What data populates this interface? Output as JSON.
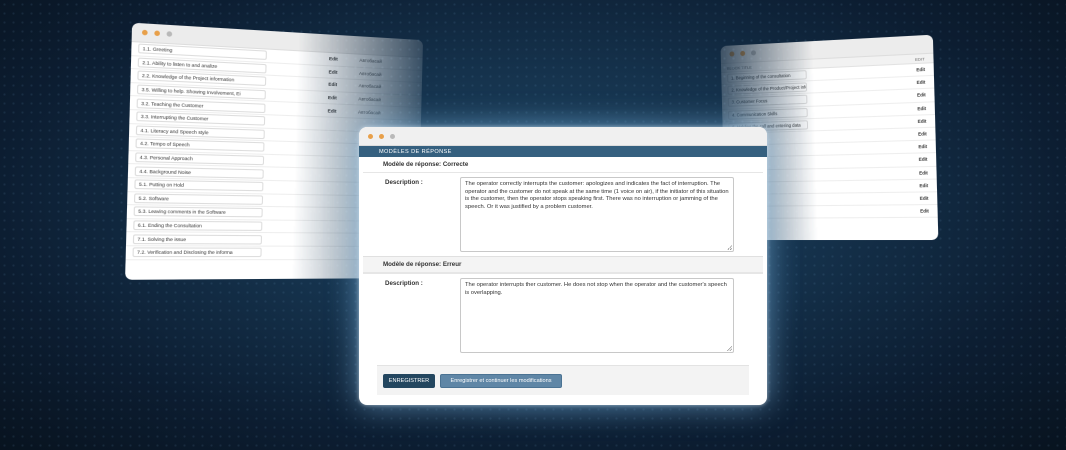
{
  "left_window": {
    "rows": [
      {
        "label": "1.1. Greeting",
        "edit": "Edit",
        "action": "Автобасай"
      },
      {
        "label": "2.1. Ability to listen to and analize",
        "edit": "Edit",
        "action": "Автобасай"
      },
      {
        "label": "2.2. Knowledge of the Project information",
        "edit": "Edit",
        "action": "Автобасай"
      },
      {
        "label": "3.5. Willing to help. Showing Involvement, Ei",
        "edit": "Edit",
        "action": "Автобасай"
      },
      {
        "label": "3.2. Teaching the Customer",
        "edit": "Edit",
        "action": "Автобасай"
      },
      {
        "label": "3.3. Interrupting the Customer",
        "edit": "",
        "action": ""
      },
      {
        "label": "4.1. Literacy and Speech style",
        "edit": "",
        "action": ""
      },
      {
        "label": "4.2. Tempo of Speech",
        "edit": "",
        "action": ""
      },
      {
        "label": "4.3. Personal Approach",
        "edit": "",
        "action": ""
      },
      {
        "label": "4.4. Background Noise",
        "edit": "",
        "action": ""
      },
      {
        "label": "5.1. Putting on Hold",
        "edit": "",
        "action": ""
      },
      {
        "label": "5.2. Software",
        "edit": "",
        "action": ""
      },
      {
        "label": "5.3. Leaving comments in the Software",
        "edit": "",
        "action": ""
      },
      {
        "label": "6.1. Ending the Consultation",
        "edit": "",
        "action": ""
      },
      {
        "label": "7.1. Solving the issue",
        "edit": "",
        "action": ""
      },
      {
        "label": "7.2. Verification and Disclosing the informa",
        "edit": "",
        "action": ""
      }
    ]
  },
  "right_window": {
    "header_left": "BLOCK TITLE",
    "header_right": "EDIT",
    "rows": [
      {
        "label": "1. Beginning of the consultation",
        "edit": "Edit"
      },
      {
        "label": "2. Knowledge of the Product/Project inform",
        "edit": "Edit"
      },
      {
        "label": "3. Customer Focus",
        "edit": "Edit"
      },
      {
        "label": "4. Communication Skills",
        "edit": "Edit"
      },
      {
        "label": "5. Holding the call and entering data",
        "edit": "Edit"
      },
      {
        "label": "",
        "edit": "Edit"
      },
      {
        "label": "",
        "edit": "Edit"
      },
      {
        "label": "",
        "edit": "Edit"
      },
      {
        "label": "",
        "edit": "Edit"
      },
      {
        "label": "",
        "edit": "Edit"
      },
      {
        "label": "",
        "edit": "Edit"
      },
      {
        "label": "",
        "edit": "Edit"
      }
    ]
  },
  "main_window": {
    "section_title": "MODÈLES DE RÉPONSE",
    "models": [
      {
        "label": "Modèle de réponse: Correcte",
        "description_label": "Description :",
        "description": "The operator correctly interrupts the customer: apologizes and indicates the fact of interruption. The operator and the customer do not speak at the same time (1 voice on air), if the initiator of this situation is the customer, then the operator stops speaking first. There was no interruption or jamming of the speech. Or it was justified by a problem customer."
      },
      {
        "label": "Modèle de réponse: Erreur",
        "description_label": "Description :",
        "description": "The operator interrupts ther customer. He does not stop when the operator and the customer's speech is overlapping."
      }
    ],
    "buttons": {
      "save": "ENREGISTRER",
      "save_continue": "Enregistrer et continuer les modifications"
    }
  }
}
